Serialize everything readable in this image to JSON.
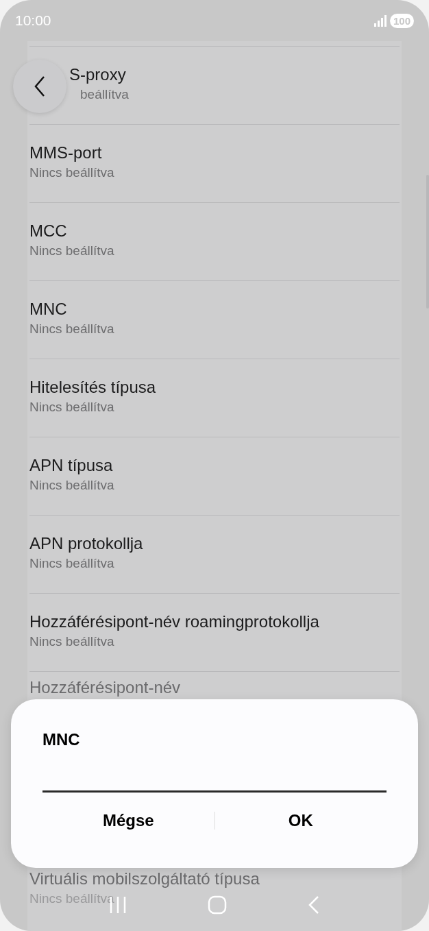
{
  "status_bar": {
    "time": "10:00",
    "battery": "100"
  },
  "settings": [
    {
      "title": "S-proxy",
      "value": "beállítva",
      "kind": "clipped"
    },
    {
      "title": "MMS-port",
      "value": "Nincs beállítva",
      "kind": "normal"
    },
    {
      "title": "MCC",
      "value": "Nincs beállítva",
      "kind": "normal"
    },
    {
      "title": "MNC",
      "value": "Nincs beállítva",
      "kind": "normal"
    },
    {
      "title": "Hitelesítés típusa",
      "value": "Nincs beállítva",
      "kind": "normal"
    },
    {
      "title": "APN típusa",
      "value": "Nincs beállítva",
      "kind": "normal"
    },
    {
      "title": "APN protokollja",
      "value": "Nincs beállítva",
      "kind": "normal"
    },
    {
      "title": "Hozzáférésipont-név roamingprotokollja",
      "value": "Nincs beállítva",
      "kind": "normal"
    },
    {
      "title": "Hozzáférésipont-név",
      "kind": "covered"
    },
    {
      "title": "Virtuális mobilszolgáltató típusa",
      "value": "Nincs beállítva",
      "kind": "faded"
    }
  ],
  "dialog": {
    "title": "MNC",
    "buttons": [
      "Mégse",
      "OK"
    ]
  }
}
